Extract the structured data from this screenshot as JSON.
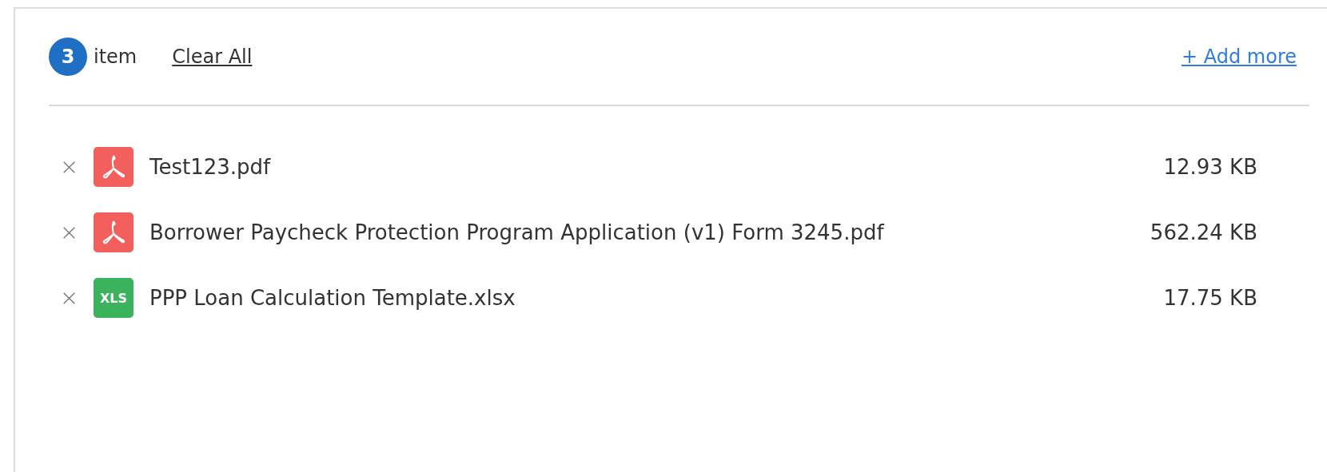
{
  "header": {
    "count": "3",
    "count_label": "item",
    "clear_all": "Clear All",
    "add_more": "+ Add more"
  },
  "files": [
    {
      "kind": "pdf",
      "name": "Test123.pdf",
      "size": "12.93 KB"
    },
    {
      "kind": "pdf",
      "name": "Borrower Paycheck Protection Program Application (v1) Form 3245.pdf",
      "size": "562.24 KB"
    },
    {
      "kind": "xls",
      "name": "PPP Loan Calculation Template.xlsx",
      "size": "17.75 KB",
      "icon_text": "XLS"
    }
  ]
}
